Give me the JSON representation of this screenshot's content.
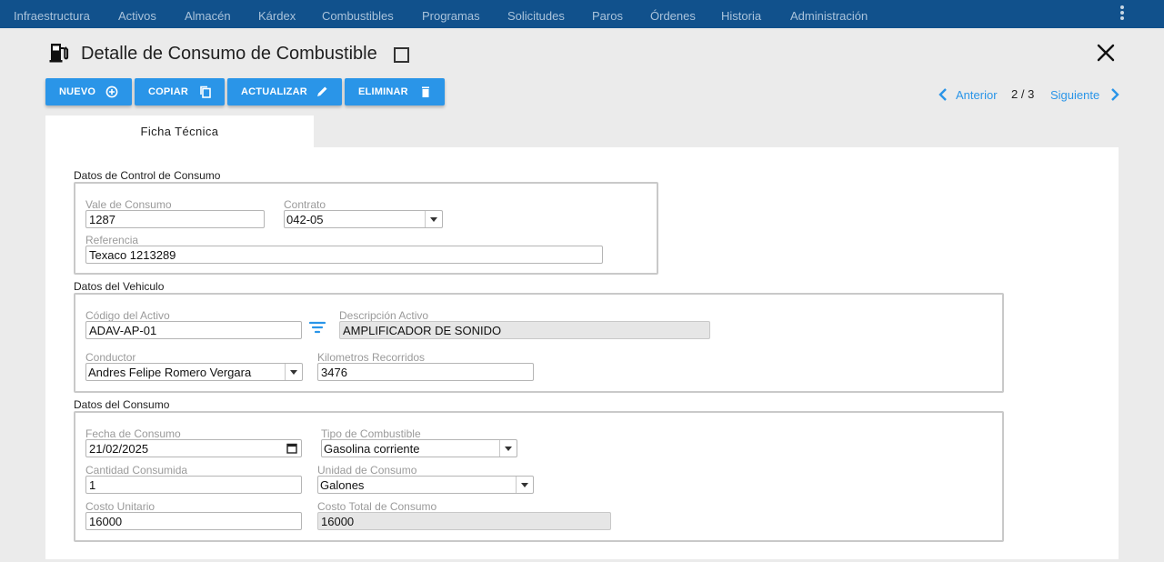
{
  "nav": {
    "items": [
      "Infraestructura",
      "Activos",
      "Almacén",
      "Kárdex",
      "Combustibles",
      "Programas",
      "Solicitudes",
      "Paros",
      "Órdenes",
      "Historia",
      "Administración"
    ],
    "bg_color": "#11518c"
  },
  "header": {
    "title": "Detalle de Consumo de Combustible",
    "icon": "fuel-pump-icon"
  },
  "toolbar": {
    "new_label": "NUEVO",
    "copy_label": "COPIAR",
    "update_label": "ACTUALIZAR",
    "delete_label": "ELIMINAR",
    "accent": "#2a95e8"
  },
  "pager": {
    "prev_label": "Anterior",
    "count": "2 / 3",
    "next_label": "Siguiente"
  },
  "tabs": [
    {
      "label": "Ficha Técnica",
      "active": true
    }
  ],
  "sections": {
    "control": {
      "title": "Datos de Control de Consumo",
      "vale_label": "Vale de Consumo",
      "vale_value": "1287",
      "contrato_label": "Contrato",
      "contrato_value": "042-05",
      "referencia_label": "Referencia",
      "referencia_value": "Texaco 1213289"
    },
    "vehiculo": {
      "title": "Datos del Vehiculo",
      "codigo_label": "Código del Activo",
      "codigo_value": "ADAV-AP-01",
      "descripcion_label": "Descripción Activo",
      "descripcion_value": "AMPLIFICADOR DE SONIDO",
      "conductor_label": "Conductor",
      "conductor_value": "Andres Felipe Romero Vergara",
      "km_label": "Kilometros Recorridos",
      "km_value": "3476"
    },
    "consumo": {
      "title": "Datos del Consumo",
      "fecha_label": "Fecha de Consumo",
      "fecha_value": "21/02/2025",
      "tipo_label": "Tipo de Combustible",
      "tipo_value": "Gasolina corriente",
      "cantidad_label": "Cantidad Consumida",
      "cantidad_value": "1",
      "unidad_label": "Unidad de Consumo",
      "unidad_value": "Galones",
      "costo_unit_label": "Costo Unitario",
      "costo_unit_value": "16000",
      "costo_total_label": "Costo Total de Consumo",
      "costo_total_value": "16000"
    }
  }
}
